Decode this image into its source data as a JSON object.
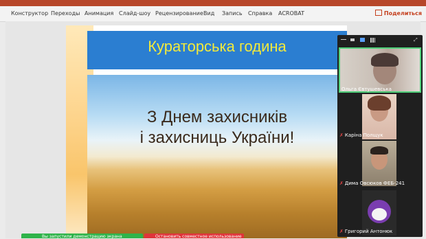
{
  "ribbon": {
    "tabs": [
      "Конструктор",
      "Переходы",
      "Анимация",
      "Слайд-шоу",
      "Рецензирование",
      "Вид",
      "Запись",
      "Справка",
      "ACROBAT"
    ],
    "share_label": "Поделиться"
  },
  "slide": {
    "title": "Кураторська година",
    "greeting_line1": "З Днем захисників",
    "greeting_line2": "і захисниць України!"
  },
  "participants": [
    {
      "name": "Ольга Євтушевська",
      "muted": false
    },
    {
      "name": "Каріна Полщук",
      "muted": true
    },
    {
      "name": "Дима Овсюков ФЕБ-241",
      "muted": true
    },
    {
      "name": "Григорий Антонюк",
      "muted": true
    }
  ],
  "bottom_bar": {
    "screen_share_notice": "Вы запустили демонстрацию экрана",
    "stop_share_label": "Остановить совместное использование"
  }
}
